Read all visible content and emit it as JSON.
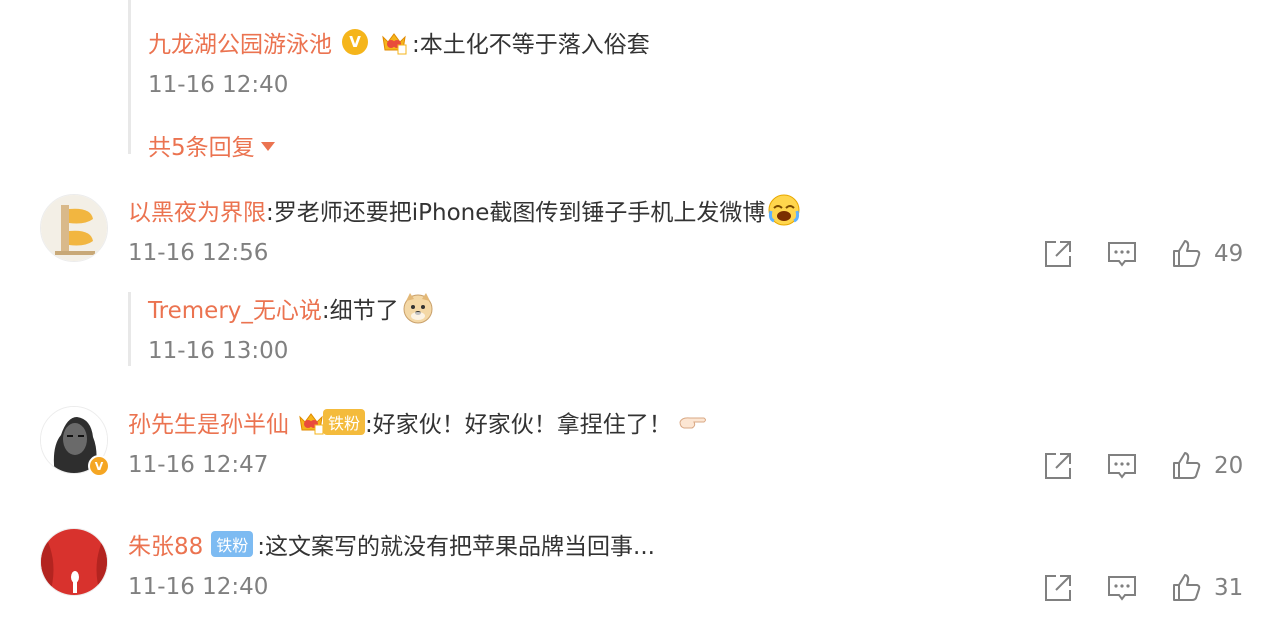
{
  "thread1": {
    "reply": {
      "author": "九龙湖公园游泳池",
      "text": ":本土化不等于落入俗套",
      "time": "11-16 12:40"
    },
    "more_replies": "共5条回复"
  },
  "comments": [
    {
      "author": "以黑夜为界限",
      "text": ":罗老师还要把iPhone截图传到锤子手机上发微博",
      "time": "11-16 12:56",
      "likes": "49",
      "reply": {
        "author": "Tremery_无心说",
        "text": ":细节了",
        "time": "11-16 13:00"
      }
    },
    {
      "author": "孙先生是孙半仙",
      "badge": "铁粉",
      "text": ":好家伙！好家伙！拿捏住了！",
      "time": "11-16 12:47",
      "likes": "20"
    },
    {
      "author": "朱张88",
      "badge": "铁粉",
      "text": ":这文案写的就没有把苹果品牌当回事...",
      "time": "11-16 12:40",
      "likes": "31"
    }
  ],
  "icons": {
    "share": "share-icon",
    "comment": "comment-icon",
    "like": "like-icon"
  },
  "colors": {
    "name": "#eb7350",
    "meta": "#808080",
    "verified": "#f5b51b",
    "fan_badge": "#7dbbf2"
  }
}
